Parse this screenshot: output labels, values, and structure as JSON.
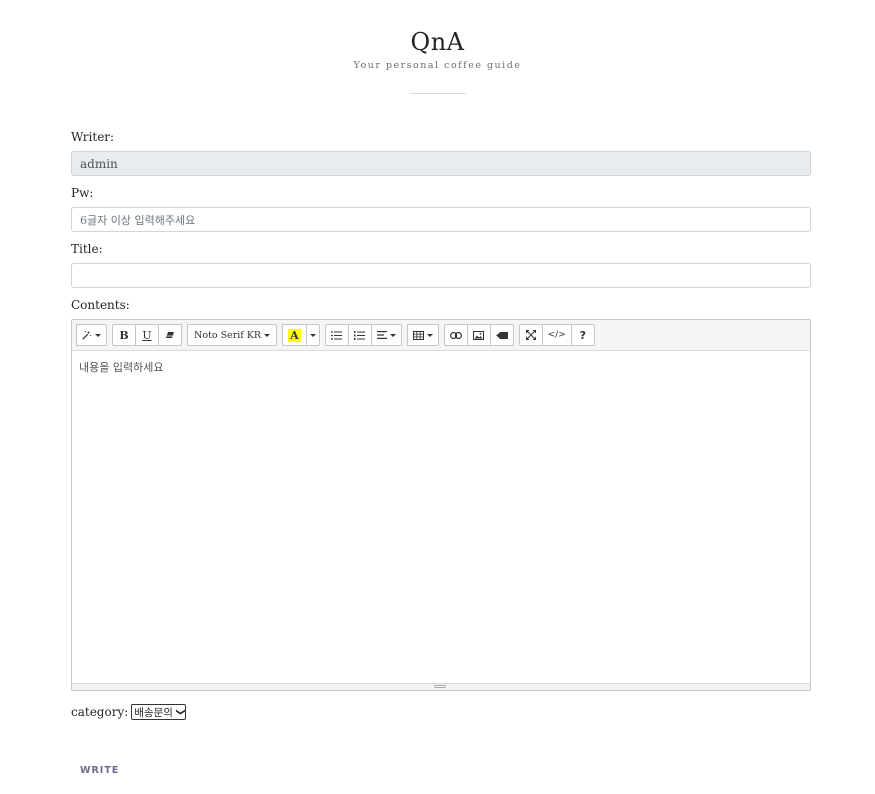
{
  "header": {
    "title": "QnA",
    "subtitle": "Your personal coffee guide"
  },
  "form": {
    "writer_label": "Writer:",
    "writer_value": "admin",
    "pw_label": "Pw:",
    "pw_placeholder": "6글자 이상 입력해주세요",
    "title_label": "Title:",
    "title_value": "",
    "contents_label": "Contents:",
    "editor": {
      "toolbar": {
        "style_icon": "magic-wand-icon",
        "bold": "B",
        "underline": "U",
        "eraser_icon": "eraser-icon",
        "font_name": "Noto Serif KR",
        "color_letter": "A",
        "ul_icon": "unordered-list-icon",
        "ol_icon": "ordered-list-icon",
        "align_icon": "align-left-icon",
        "table_icon": "table-icon",
        "link_icon": "link-icon",
        "picture_icon": "picture-icon",
        "video_icon": "video-icon",
        "fullscreen_icon": "fullscreen-icon",
        "code_view": "</>",
        "help": "?"
      },
      "placeholder": "내용을 입력하세요"
    },
    "category_label": "category:",
    "category_selected": "배송문의",
    "submit_label": "WRITE"
  },
  "colors": {
    "readonly_bg": "#e9ecef",
    "border": "#ced4da",
    "highlight": "#ffff00",
    "submit_text": "#6a6a8a"
  }
}
